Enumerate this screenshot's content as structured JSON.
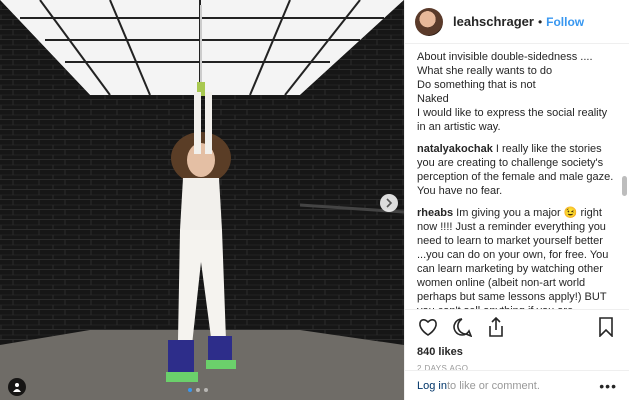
{
  "post": {
    "username": "leahschrager",
    "separator": "•",
    "follow_label": "Follow"
  },
  "caption_lines": [
    "About invisible double-sidedness ....",
    "What she really wants to do",
    "Do something that is not",
    "Naked",
    "I would like to express the social reality in an artistic way."
  ],
  "comments": [
    {
      "user": "natalyakochak",
      "text": "I really like the stories you are creating to challenge society's perception of the female and male gaze. You have no fear."
    },
    {
      "user": "rheabs",
      "text": "Im giving you a major 😉 right now !!!! Just a reminder everything you need to learn to market yourself better ...you can do on your own, for free. You can learn marketing by watching other women online (albeit non-art world perhaps but same lessons apply!) BUT you can't sell anything if you are insecure about your product. Haters and trolls will ALWAYZ be there ! So that has nothing to with sellability. Saying you get a lot of hate"
    }
  ],
  "actions": {
    "icons": [
      "heart-icon",
      "comment-icon",
      "share-icon",
      "bookmark-icon"
    ]
  },
  "likes": "840 likes",
  "age": "2 DAYS AGO",
  "login": {
    "link": "Log in",
    "rest": " to like or comment.",
    "more": "•••"
  },
  "carousel": {
    "slides": 3,
    "active": 0
  }
}
